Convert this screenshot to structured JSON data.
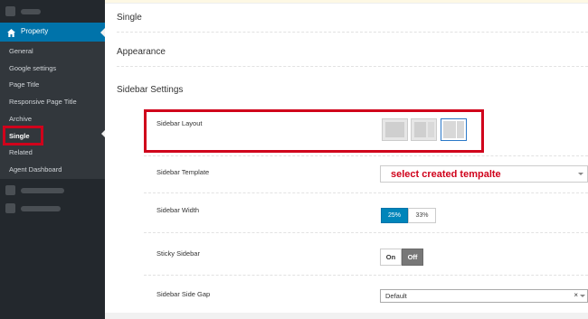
{
  "sidebar": {
    "active_menu": {
      "label": "Property",
      "icon": "home-icon"
    },
    "items": [
      {
        "label": "General"
      },
      {
        "label": "Google settings"
      },
      {
        "label": "Page Title"
      },
      {
        "label": "Responsive Page Title"
      },
      {
        "label": "Archive"
      },
      {
        "label": "Single",
        "current": true
      },
      {
        "label": "Related"
      },
      {
        "label": "Agent Dashboard"
      }
    ]
  },
  "main": {
    "sections": [
      {
        "title": "Single"
      },
      {
        "title": "Appearance"
      },
      {
        "title": "Sidebar Settings"
      }
    ],
    "fields": {
      "sidebar_layout": {
        "label": "Sidebar Layout",
        "options": [
          "left-sidebar",
          "right-sidebar",
          "right-sidebar-selected"
        ],
        "selected_index": 2
      },
      "sidebar_template": {
        "label": "Sidebar Template",
        "value": "select created tempalte"
      },
      "sidebar_width": {
        "label": "Sidebar Width",
        "options": [
          "25%",
          "33%"
        ],
        "selected": "25%"
      },
      "sticky_sidebar": {
        "label": "Sticky Sidebar",
        "on_label": "On",
        "off_label": "Off",
        "state": "Off"
      },
      "sidebar_side_gap": {
        "label": "Sidebar Side Gap",
        "value": "Default",
        "clear": "×"
      }
    }
  },
  "colors": {
    "admin_bar": "#23282d",
    "active_blue": "#0073aa",
    "annotation_red": "#d0021b",
    "segment_blue": "#0085ba"
  }
}
